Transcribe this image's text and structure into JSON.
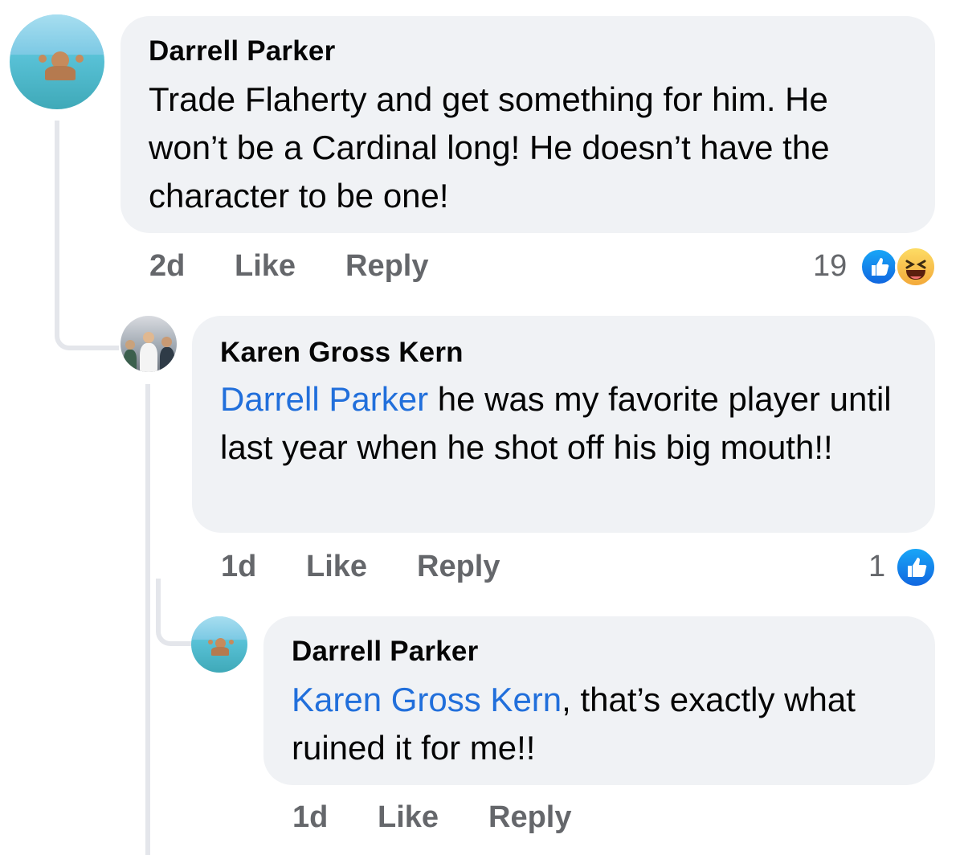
{
  "comments": [
    {
      "author": "Darrell Parker",
      "mention": "",
      "text": "Trade Flaherty and get something for him. He won’t be a Cardinal long! He doesn’t have the character to be one!",
      "time": "2d",
      "like_label": "Like",
      "reply_label": "Reply",
      "reaction_count": "19",
      "reactions": [
        "like-icon",
        "haha-icon"
      ]
    },
    {
      "author": "Karen Gross Kern",
      "mention": "Darrell Parker",
      "text": " he was my favorite player until last year when he shot off his big mouth!!",
      "time": "1d",
      "like_label": "Like",
      "reply_label": "Reply",
      "reaction_count": "1",
      "reactions": [
        "like-icon"
      ]
    },
    {
      "author": "Darrell Parker",
      "mention": "Karen Gross Kern",
      "text": ", that’s exactly what ruined it for me!!",
      "time": "1d",
      "like_label": "Like",
      "reply_label": "Reply",
      "reaction_count": "",
      "reactions": []
    }
  ],
  "colors": {
    "bubble": "#f0f2f5",
    "mention": "#216fdb",
    "meta": "#65676b",
    "thread_line": "#e4e6eb"
  }
}
